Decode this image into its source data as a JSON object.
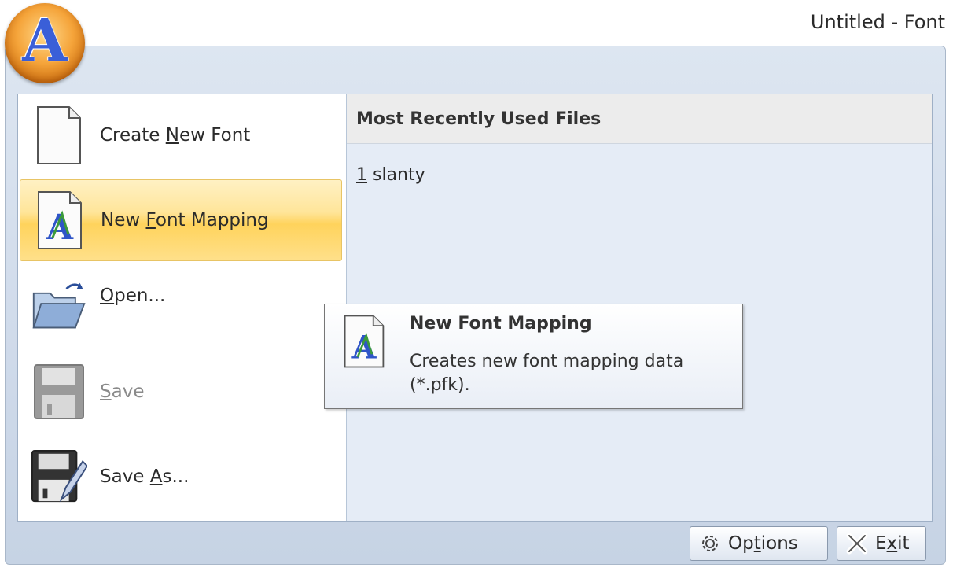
{
  "window": {
    "title": "Untitled - Font"
  },
  "app_button": {
    "letter": "A",
    "icon": "app-logo-icon"
  },
  "menu": {
    "items": [
      {
        "id": "create-new-font",
        "pre": "Create ",
        "key": "N",
        "post": "ew Font",
        "icon": "blank-page-icon",
        "state": "normal"
      },
      {
        "id": "new-font-mapping",
        "pre": "New ",
        "key": "F",
        "post": "ont Mapping",
        "icon": "font-mapping-icon",
        "state": "hover"
      },
      {
        "id": "open",
        "pre": "",
        "key": "O",
        "post": "pen...",
        "icon": "folder-open-icon",
        "state": "normal"
      },
      {
        "id": "save",
        "pre": "",
        "key": "S",
        "post": "ave",
        "icon": "floppy-disk-icon",
        "state": "disabled"
      },
      {
        "id": "save-as",
        "pre": "Save ",
        "key": "A",
        "post": "s...",
        "icon": "floppy-pencil-icon",
        "state": "normal"
      }
    ]
  },
  "mru": {
    "header": "Most Recently Used Files",
    "items": [
      {
        "index": "1",
        "name": " slanty"
      }
    ]
  },
  "footer": {
    "options": {
      "pre": "Op",
      "key": "t",
      "post": "ions",
      "icon": "gear-icon"
    },
    "exit": {
      "pre": "E",
      "key": "x",
      "post": "it",
      "icon": "close-x-icon"
    }
  },
  "tooltip": {
    "title": "New Font Mapping",
    "description": "Creates new font mapping data (*.pfk).",
    "icon": "font-mapping-icon"
  },
  "colors": {
    "highlight": "#ffd35c",
    "accent_blue": "#3a5fd8",
    "pane_bg": "#e5ecf6"
  }
}
